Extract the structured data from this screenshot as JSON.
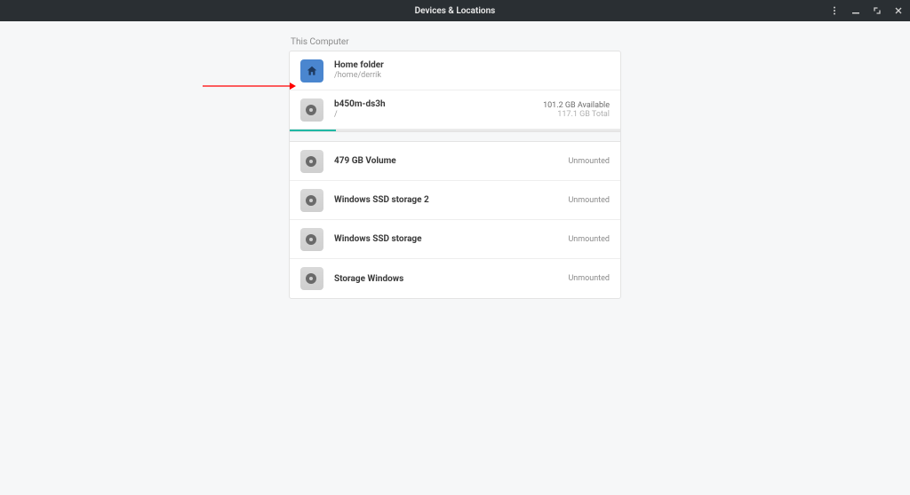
{
  "titlebar": {
    "title": "Devices & Locations"
  },
  "section": {
    "label": "This Computer"
  },
  "rows": {
    "home": {
      "title": "Home folder",
      "path": "/home/derrik"
    },
    "root": {
      "title": "b450m-ds3h",
      "path": "/",
      "available": "101.2 GB Available",
      "total": "117.1 GB Total"
    },
    "vol1": {
      "title": "479 GB Volume",
      "status": "Unmounted"
    },
    "vol2": {
      "title": "Windows SSD storage 2",
      "status": "Unmounted"
    },
    "vol3": {
      "title": "Windows SSD storage",
      "status": "Unmounted"
    },
    "vol4": {
      "title": "Storage Windows",
      "status": "Unmounted"
    }
  }
}
